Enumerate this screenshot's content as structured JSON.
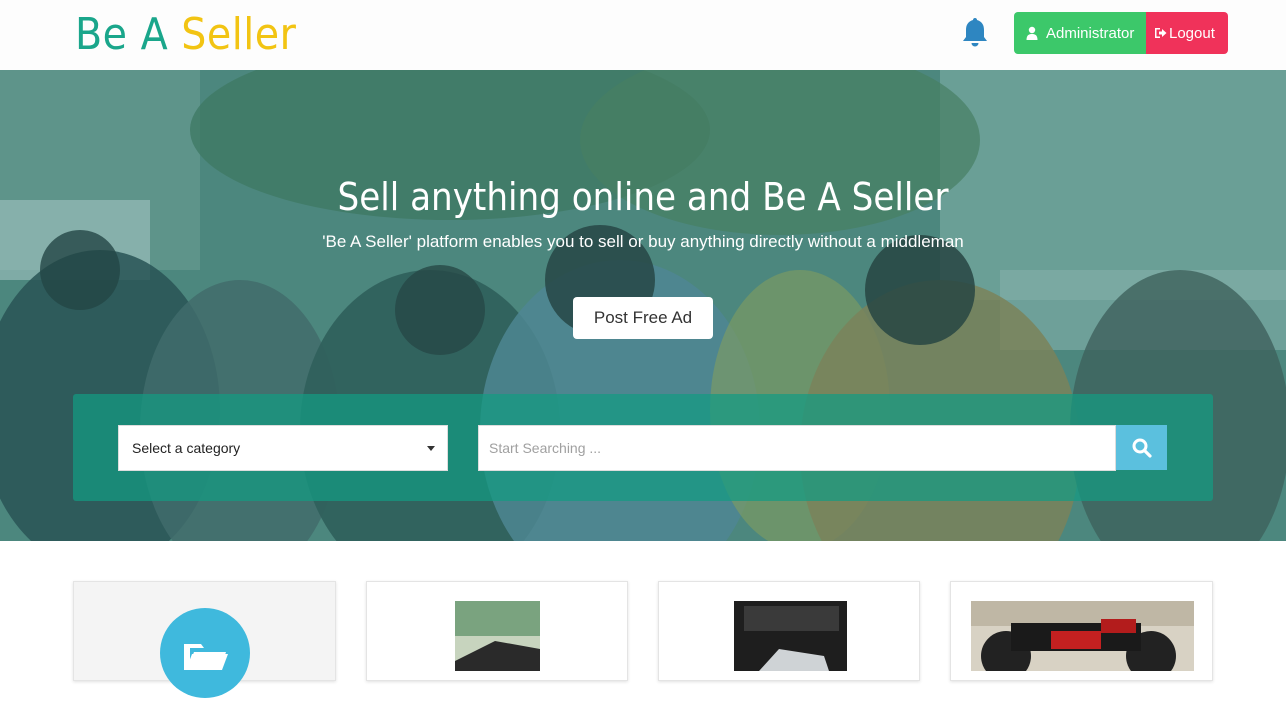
{
  "header": {
    "logo_part1": "Be A",
    "logo_part2": "Seller",
    "notification_icon": "bell-icon",
    "admin_label": "Administrator",
    "logout_label": "Logout"
  },
  "hero": {
    "title": "Sell anything online and Be A Seller",
    "subtitle": "'Be A Seller' platform enables you to sell or buy anything directly without a middleman",
    "post_button": "Post Free Ad"
  },
  "search": {
    "category_selected": "Select a category",
    "placeholder": "Start Searching ...",
    "button_icon": "search-icon"
  },
  "listings": {
    "cards": [
      {
        "type": "category",
        "icon": "folder-open-icon"
      },
      {
        "type": "product",
        "image": "tablet-photo"
      },
      {
        "type": "product",
        "image": "device-photo"
      },
      {
        "type": "product",
        "image": "motorcycle-photo"
      }
    ]
  },
  "colors": {
    "brand_green": "#1aa68b",
    "brand_yellow": "#f2c413",
    "admin_green": "#3cc86a",
    "logout_red": "#f0325a",
    "search_blue": "#5bc0de"
  }
}
